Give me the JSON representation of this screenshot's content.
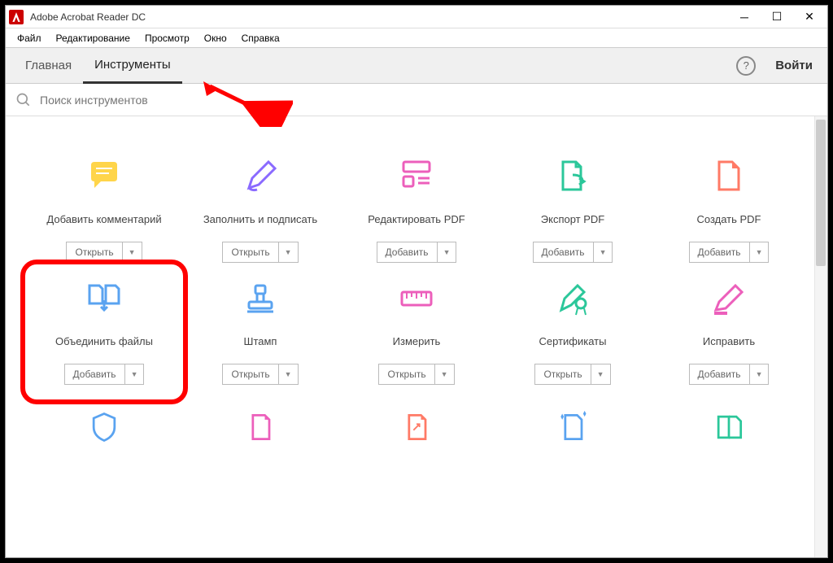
{
  "app": {
    "title": "Adobe Acrobat Reader DC"
  },
  "menu": {
    "file": "Файл",
    "edit": "Редактирование",
    "view": "Просмотр",
    "window": "Окно",
    "help": "Справка"
  },
  "tabs": {
    "home": "Главная",
    "tools": "Инструменты",
    "login": "Войти"
  },
  "search": {
    "placeholder": "Поиск инструментов"
  },
  "actions": {
    "open": "Открыть",
    "add": "Добавить"
  },
  "tools": [
    {
      "name": "Добавить комментарий",
      "action": "open"
    },
    {
      "name": "Заполнить и подписать",
      "action": "open"
    },
    {
      "name": "Редактировать PDF",
      "action": "add"
    },
    {
      "name": "Экспорт PDF",
      "action": "add"
    },
    {
      "name": "Создать PDF",
      "action": "add"
    },
    {
      "name": "Объединить файлы",
      "action": "add"
    },
    {
      "name": "Штамп",
      "action": "open"
    },
    {
      "name": "Измерить",
      "action": "open"
    },
    {
      "name": "Сертификаты",
      "action": "open"
    },
    {
      "name": "Исправить",
      "action": "add"
    }
  ]
}
